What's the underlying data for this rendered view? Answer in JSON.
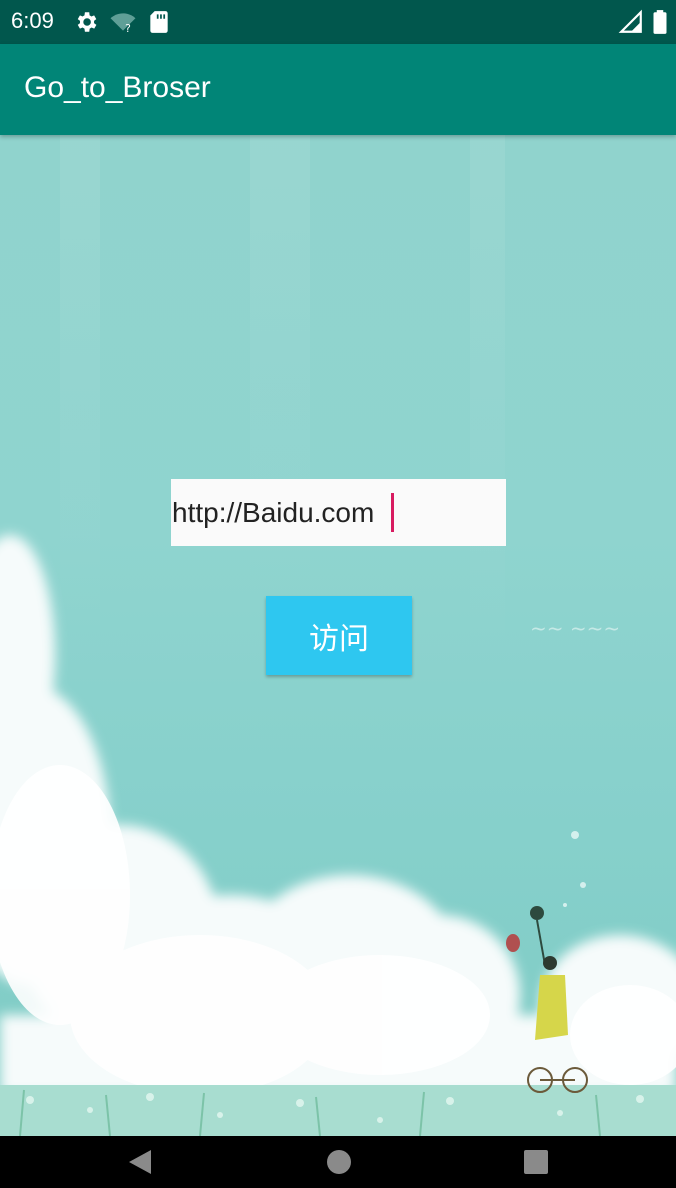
{
  "status_bar": {
    "time": "6:09",
    "icons": [
      "gear-icon",
      "wifi-unknown-icon",
      "sd-card-icon",
      "signal-icon",
      "battery-icon"
    ]
  },
  "app_bar": {
    "title": "Go_to_Broser"
  },
  "form": {
    "url_value": "http://Baidu.com",
    "visit_label": "访问"
  },
  "colors": {
    "status_bar": "#01574d",
    "app_bar": "#018577",
    "button": "#2ec7f0",
    "caret": "#d81b60",
    "background": "#8fd4cf"
  },
  "nav_bar": {
    "icons": [
      "back-icon",
      "home-icon",
      "recents-icon"
    ]
  }
}
